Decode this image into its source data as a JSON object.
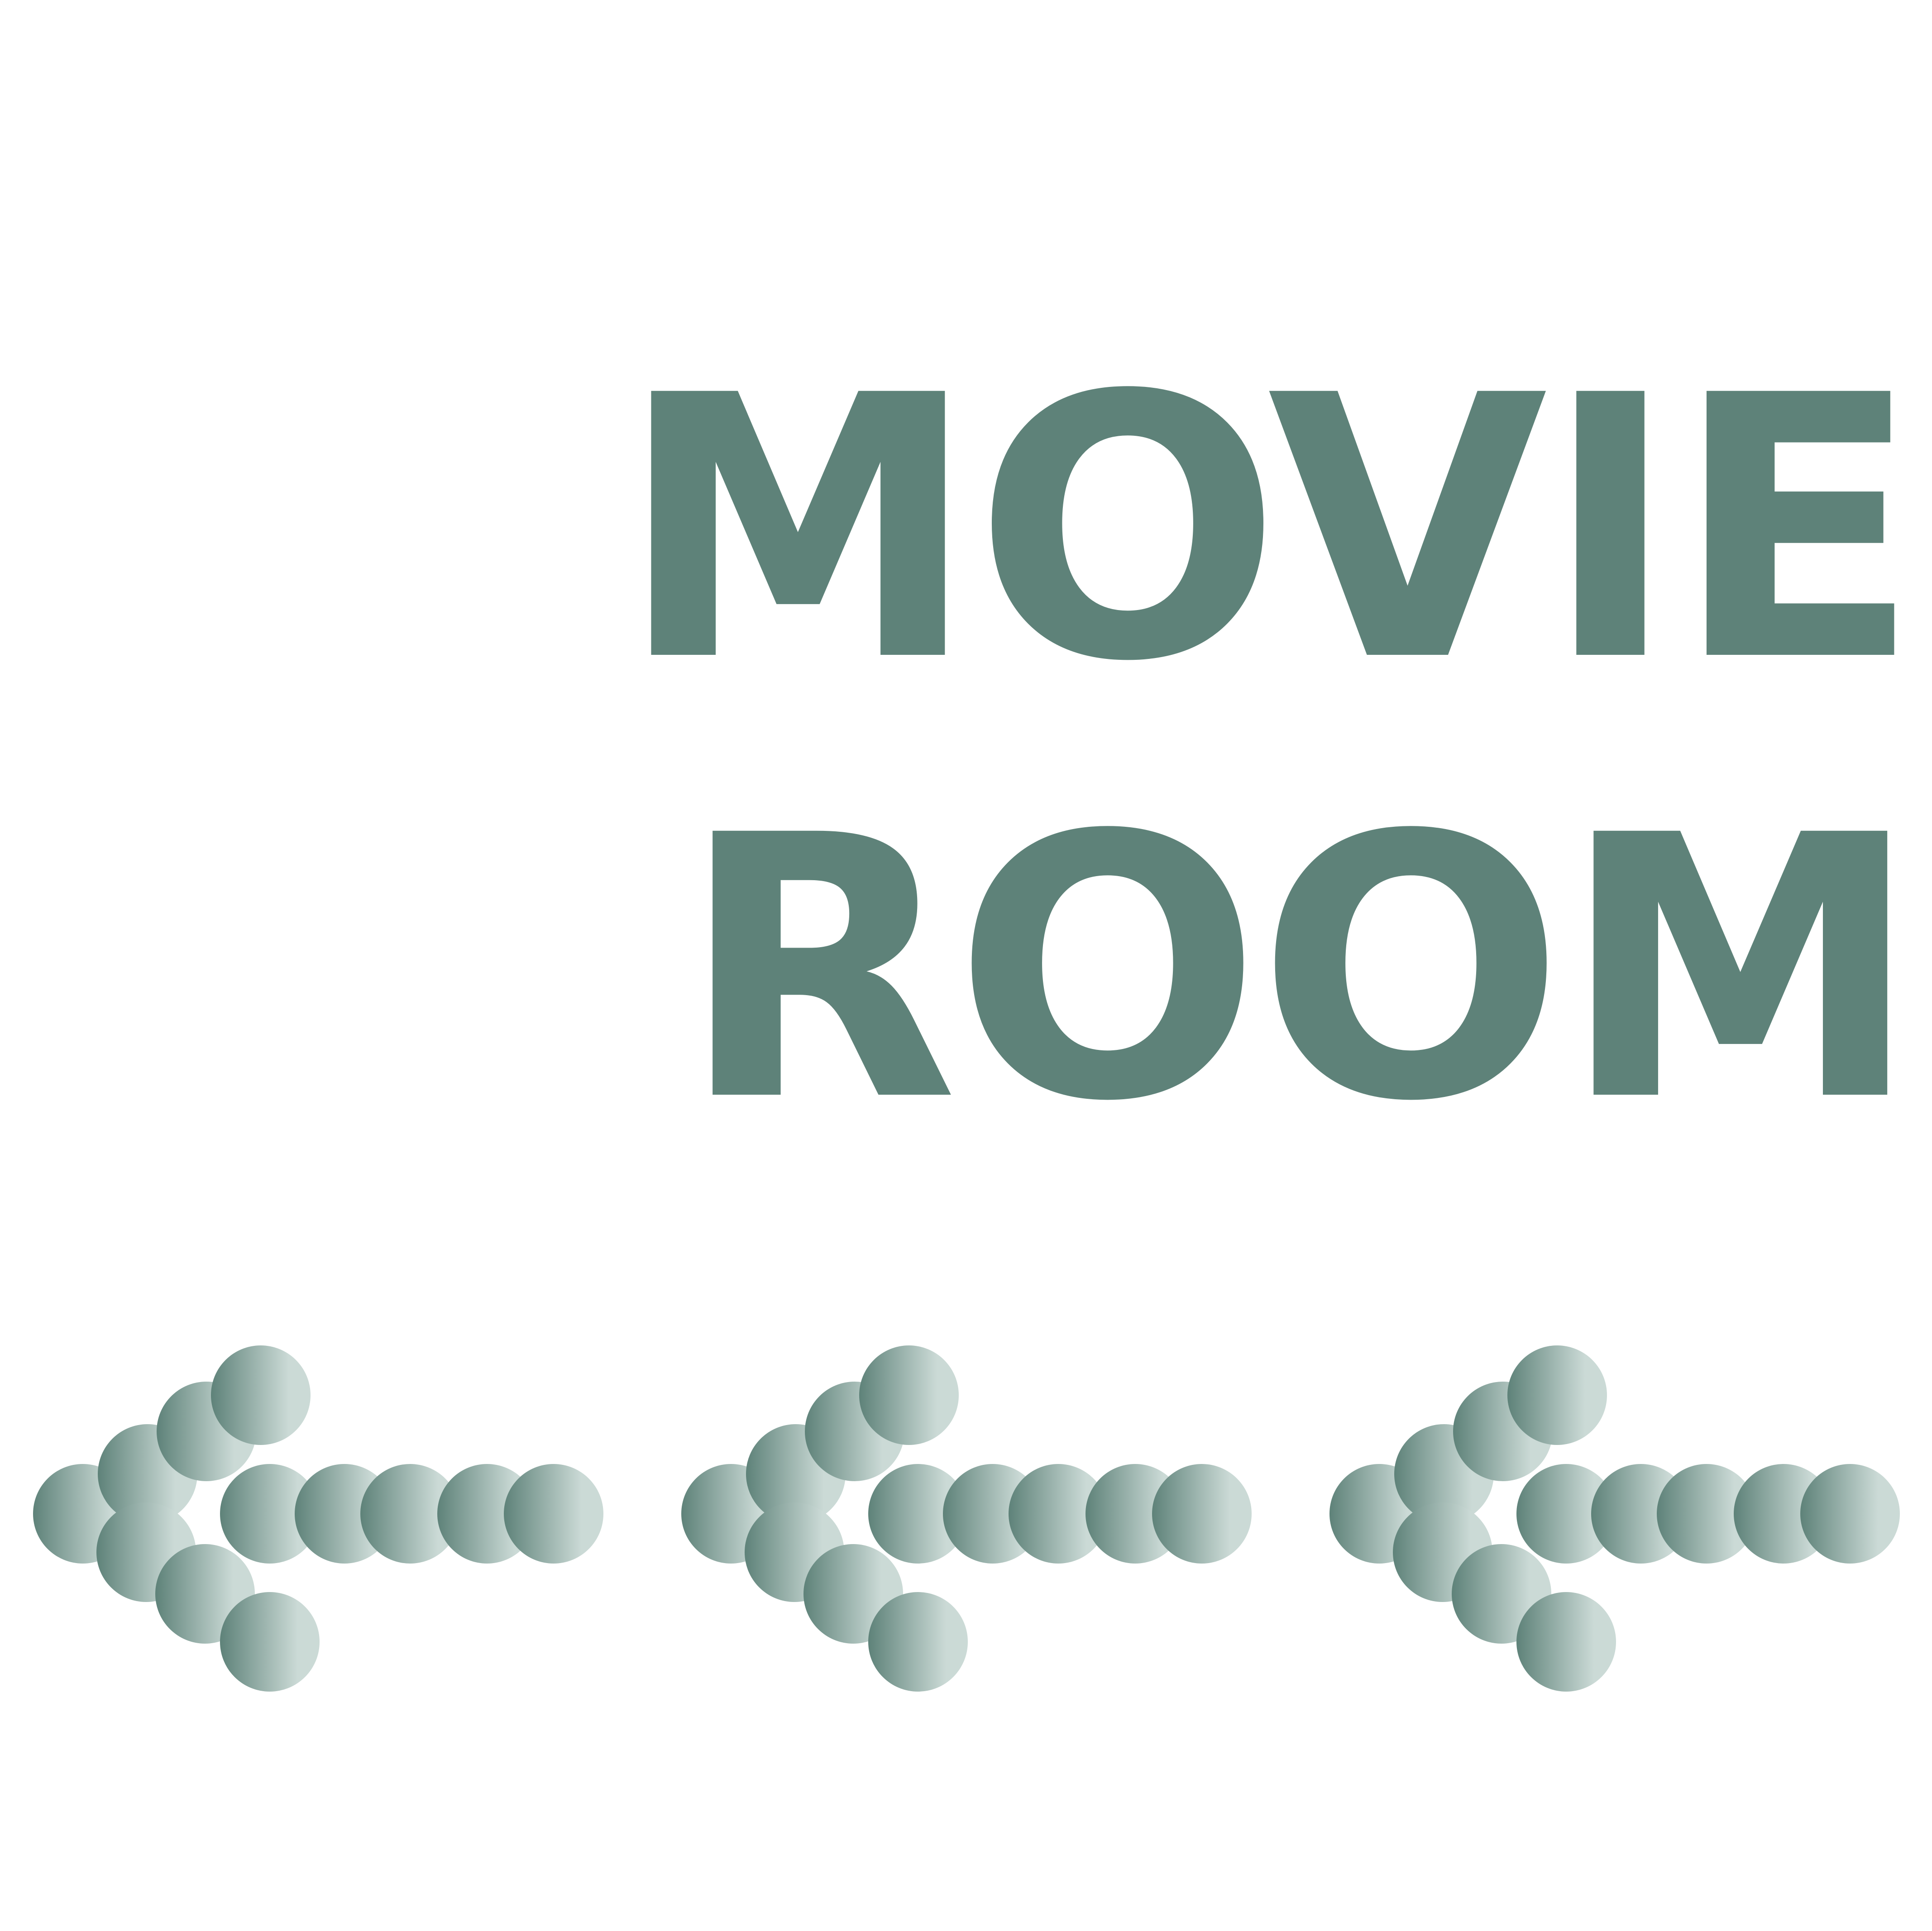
{
  "sign": {
    "title_line_1": "MOVIE",
    "title_line_2": "ROOM",
    "text_color": "#5e8279",
    "arrows": {
      "count": 3,
      "direction": "left",
      "icon": "dotted-arrow-left-icon",
      "gradient_start_color": "#5e8279",
      "gradient_end_color": "#cbdad6"
    }
  }
}
